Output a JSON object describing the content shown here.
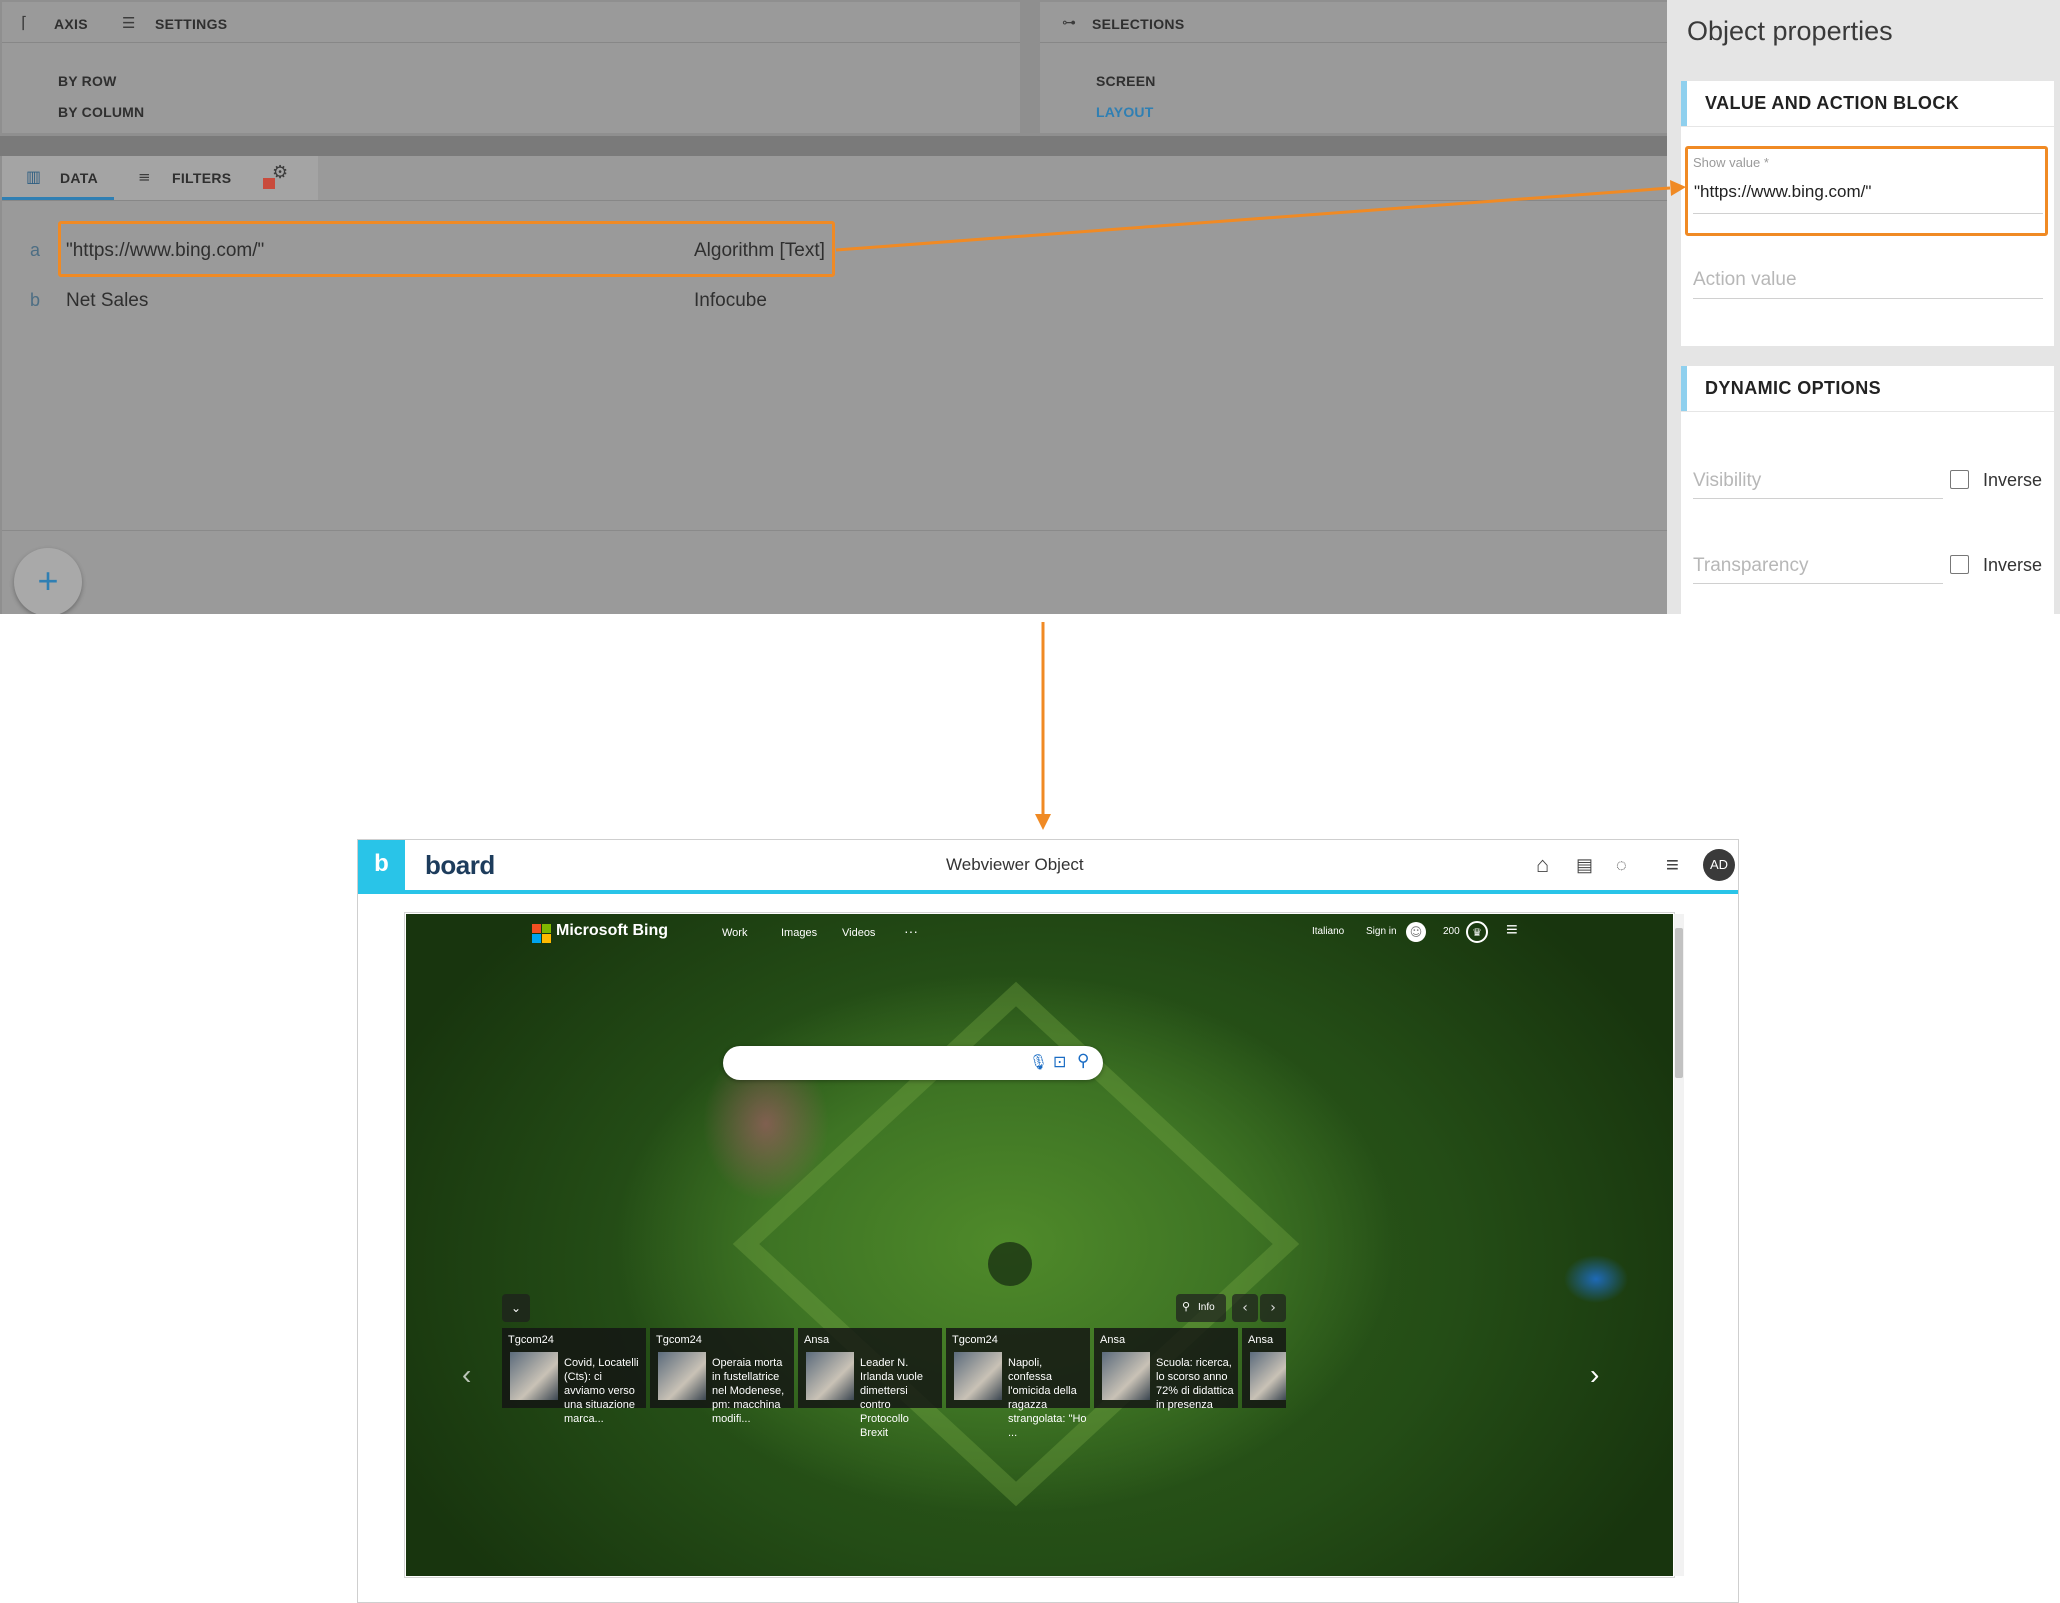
{
  "designer": {
    "axis_tab": "AXIS",
    "settings_tab": "SETTINGS",
    "axis_options": [
      "BY ROW",
      "BY COLUMN"
    ],
    "selections_tab": "SELECTIONS",
    "selection_options": [
      "SCREEN",
      "LAYOUT"
    ],
    "bottom_tabs": {
      "data": "DATA",
      "filters": "FILTERS"
    },
    "rows": [
      {
        "letter": "a",
        "value": "\"https://www.bing.com/\"",
        "source": "Algorithm [Text]"
      },
      {
        "letter": "b",
        "value": "Net Sales",
        "source": "Infocube"
      }
    ],
    "add_button": "+"
  },
  "props": {
    "title": "Object properties",
    "section1": "VALUE AND ACTION BLOCK",
    "show_value_label": "Show value *",
    "show_value": "\"https://www.bing.com/\"",
    "action_value_placeholder": "Action value",
    "section2": "DYNAMIC OPTIONS",
    "visibility_placeholder": "Visibility",
    "transparency_placeholder": "Transparency",
    "inverse": "Inverse"
  },
  "board": {
    "logo_letter": "b",
    "brand": "board",
    "page_title": "Webviewer Object",
    "avatar": "AD"
  },
  "bing": {
    "brand": "Microsoft Bing",
    "nav": [
      "Work",
      "Images",
      "Videos",
      "···"
    ],
    "language": "Italiano",
    "sign_in": "Sign in",
    "points": "200",
    "info": "Info",
    "news": [
      {
        "source": "Tgcom24",
        "title": "Covid, Locatelli (Cts): ci avviamo verso una situazione marca..."
      },
      {
        "source": "Tgcom24",
        "title": "Operaia morta in fustellatrice nel Modenese, pm: macchina modifi..."
      },
      {
        "source": "Ansa",
        "title": "Leader N. Irlanda vuole dimettersi contro Protocollo Brexit"
      },
      {
        "source": "Tgcom24",
        "title": "Napoli, confessa l'omicida della ragazza strangolata: \"Ho ..."
      },
      {
        "source": "Ansa",
        "title": "Scuola: ricerca, lo scorso anno 72% di didattica in presenza"
      },
      {
        "source": "Ansa",
        "title": ""
      }
    ]
  },
  "colors": {
    "accent_orange": "#f08a24",
    "board_cyan": "#29c4e8",
    "link_blue": "#2f9bd6",
    "section_bar": "#8fd0ee"
  }
}
